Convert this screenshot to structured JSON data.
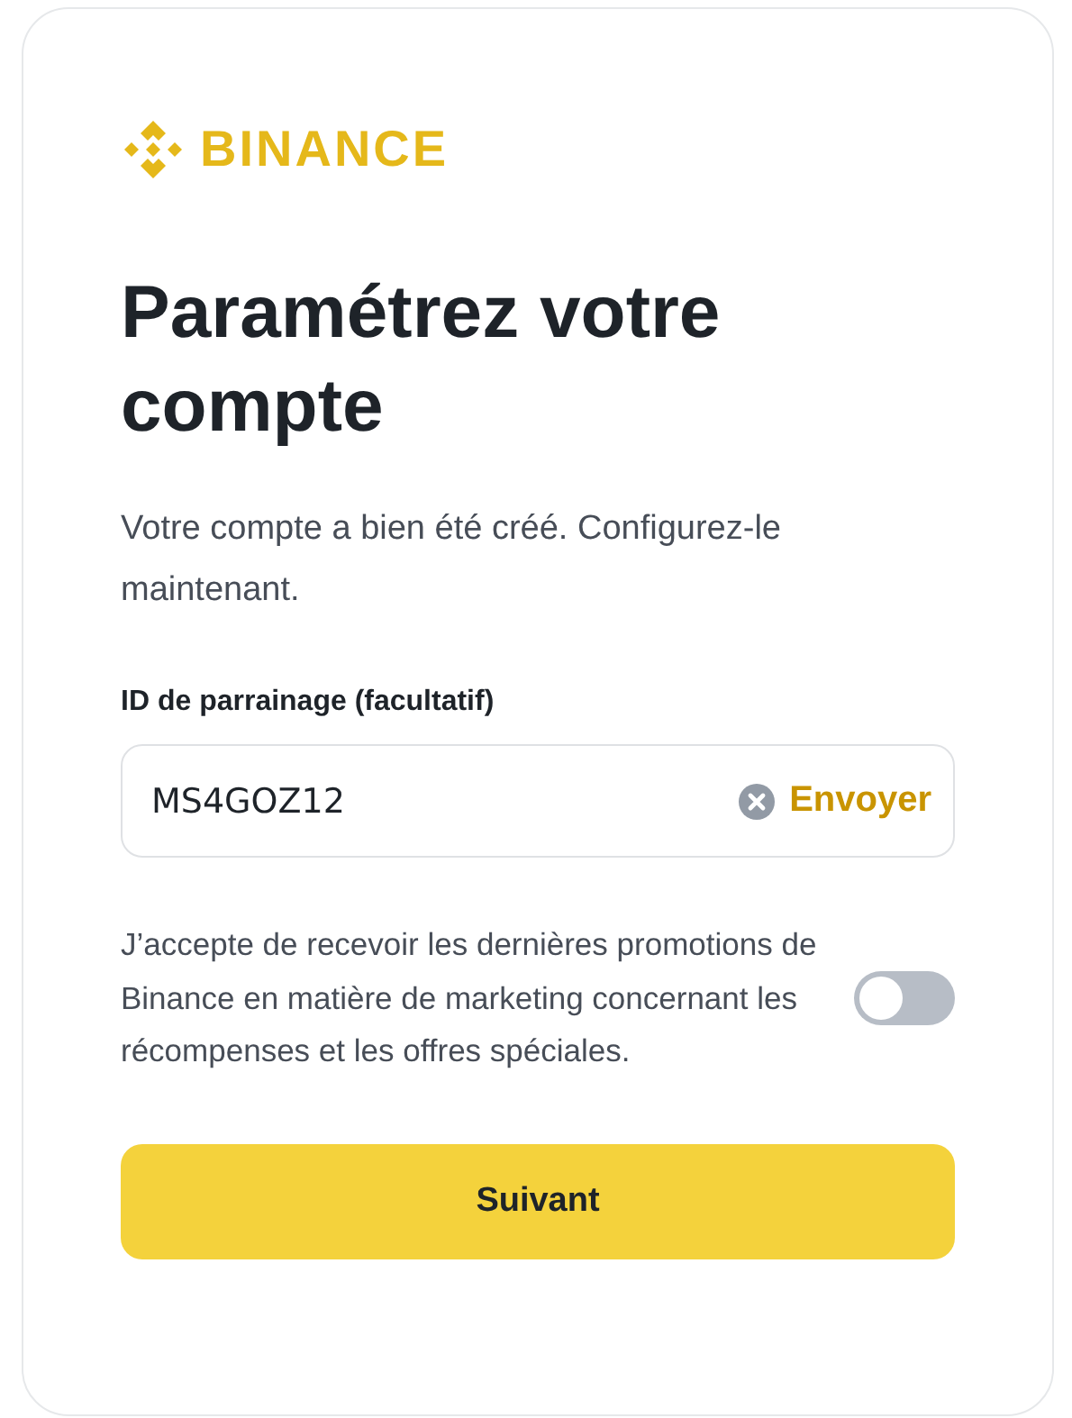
{
  "logo": {
    "text": "BINANCE"
  },
  "title": "Paramétrez votre compte",
  "subtitle": "Votre compte a bien été créé. Configurez-le maintenant.",
  "referral": {
    "label": "ID de parrainage (facultatif)",
    "value": "MS4GOZ12",
    "action": "Envoyer"
  },
  "consent": {
    "text": "J’accepte de recevoir les dernières promotions de Binance en matière de marketing concernant les récompenses et les offres spéciales.",
    "on": false
  },
  "button": "Suivant"
}
